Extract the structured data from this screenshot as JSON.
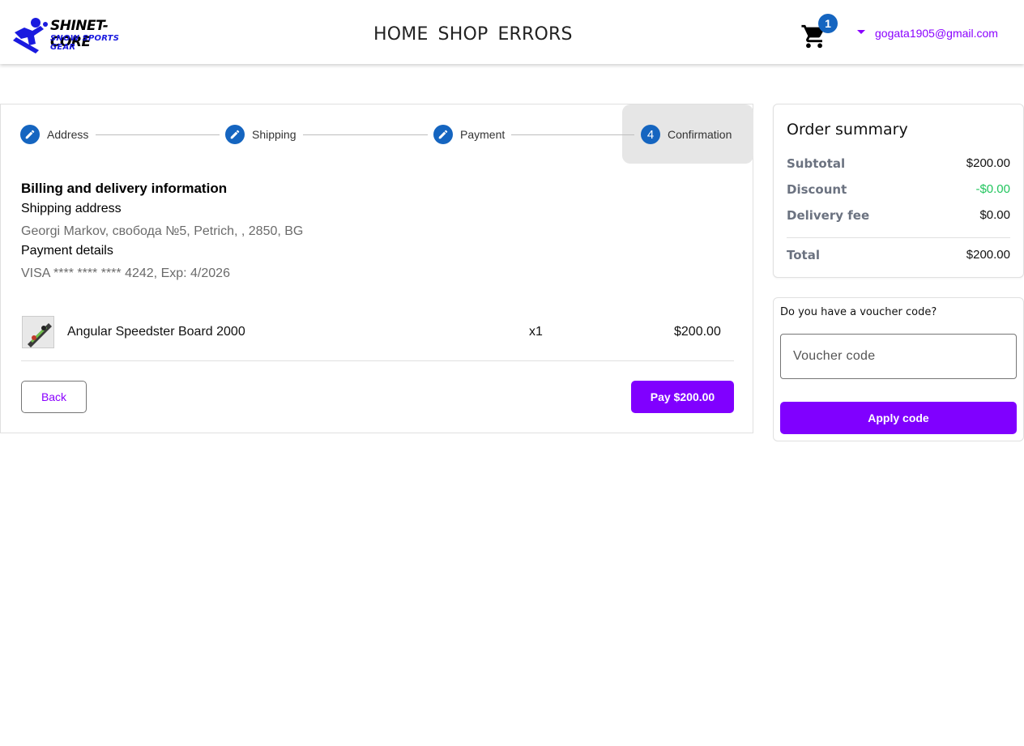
{
  "header": {
    "logo_title": "SHINET-CORE",
    "logo_subtitle": "SNOW SPORTS GEAR",
    "nav": [
      "HOME",
      "SHOP",
      "ERRORS"
    ],
    "cart_count": "1",
    "user_email": "gogata1905@gmail.com"
  },
  "stepper": {
    "steps": [
      {
        "label": "Address",
        "icon": "pencil-icon"
      },
      {
        "label": "Shipping",
        "icon": "pencil-icon"
      },
      {
        "label": "Payment",
        "icon": "pencil-icon"
      },
      {
        "label": "Confirmation",
        "number": "4"
      }
    ],
    "active_step": "Confirmation"
  },
  "billing": {
    "title": "Billing and delivery information",
    "shipping_label": "Shipping address",
    "shipping_value": "Georgi Markov, свобода №5, Petrich, , 2850, BG",
    "payment_label": "Payment details",
    "payment_value": "VISA **** **** **** 4242, Exp: 4/2026"
  },
  "order_items": [
    {
      "name": "Angular Speedster Board 2000",
      "quantity": "x1",
      "price": "$200.00"
    }
  ],
  "actions": {
    "back_label": "Back",
    "pay_label": "Pay $200.00"
  },
  "summary": {
    "title": "Order summary",
    "subtotal_label": "Subtotal",
    "subtotal_value": "$200.00",
    "discount_label": "Discount",
    "discount_value": "-$0.00",
    "delivery_label": "Delivery fee",
    "delivery_value": "$0.00",
    "total_label": "Total",
    "total_value": "$200.00"
  },
  "voucher": {
    "question": "Do you have a voucher code?",
    "placeholder": "Voucher code",
    "apply_label": "Apply code"
  },
  "colors": {
    "accent": "#8000ff",
    "step_blue": "#1565c0",
    "discount_green": "#22c55e"
  }
}
